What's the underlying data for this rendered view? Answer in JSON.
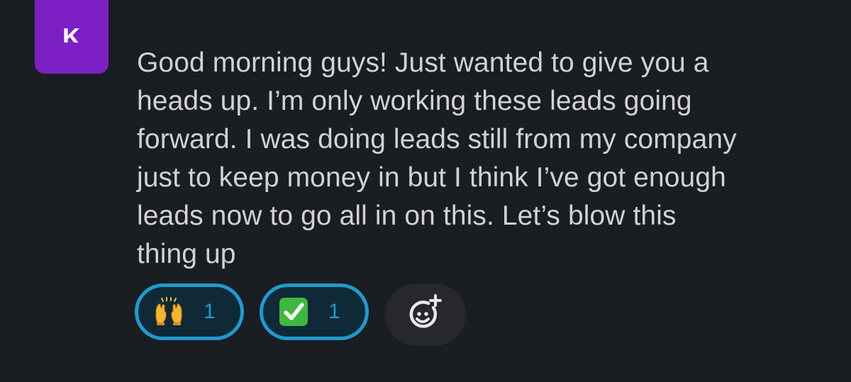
{
  "message": {
    "avatar_initial": "K",
    "lines": [
      "Good morning guys! Just wanted to give you a",
      "heads up. I’m only working these leads going",
      "forward. I was doing leads still from my company",
      "just to keep money in but I think I’ve got enough",
      "leads now to go all in on this. Let’s blow this",
      "thing up"
    ]
  },
  "reactions": [
    {
      "icon": "raising-hands-emoji",
      "count": "1"
    },
    {
      "icon": "white-check-mark-emoji",
      "count": "1"
    }
  ],
  "add_reaction": {
    "icon": "add-reaction-icon"
  },
  "colors": {
    "background": "#1a1d21",
    "text": "#d1d2d3",
    "avatar": "#7c1fc4",
    "reaction_border": "#1d9bd1",
    "reaction_bg": "#0f2937",
    "add_reaction_bg": "#26282d"
  }
}
